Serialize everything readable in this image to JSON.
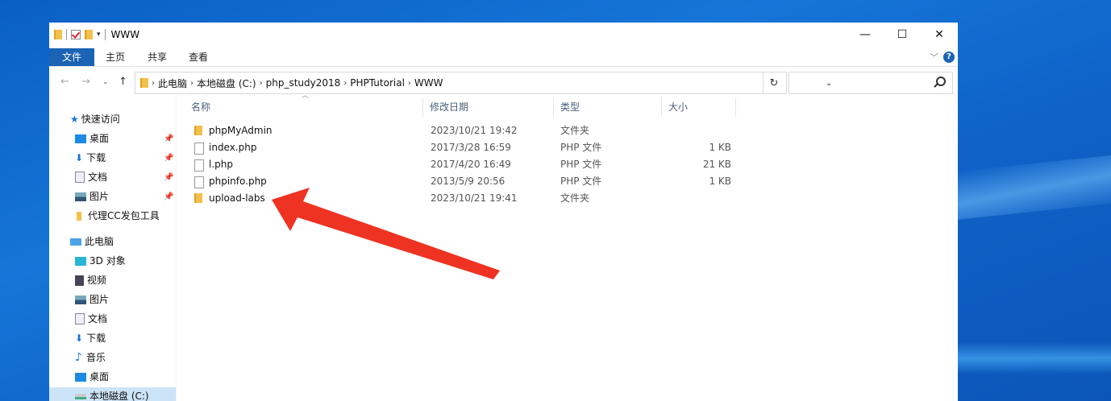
{
  "window": {
    "title": "WWW",
    "controls": {
      "minimize": "—",
      "maximize": "☐",
      "close": "✕"
    }
  },
  "ribbon": {
    "tabs": [
      "文件",
      "主页",
      "共享",
      "查看"
    ],
    "expand_icon": "chevron-down-icon",
    "help": "?"
  },
  "address": {
    "crumbs": [
      "此电脑",
      "本地磁盘 (C:)",
      "php_study2018",
      "PHPTutorial",
      "WWW"
    ],
    "search_placeholder": ""
  },
  "navpane": {
    "quick_access": "快速访问",
    "quick_items": [
      "桌面",
      "下载",
      "文档",
      "图片",
      "代理CC发包工具"
    ],
    "this_pc": "此电脑",
    "pc_items": [
      "3D 对象",
      "视频",
      "图片",
      "文档",
      "下载",
      "音乐",
      "桌面",
      "本地磁盘 (C:)"
    ]
  },
  "columns": {
    "name": "名称",
    "date": "修改日期",
    "type": "类型",
    "size": "大小"
  },
  "files": [
    {
      "name": "phpMyAdmin",
      "date": "2023/10/21 19:42",
      "type": "文件夹",
      "size": "",
      "kind": "folder"
    },
    {
      "name": "index.php",
      "date": "2017/3/28 16:59",
      "type": "PHP 文件",
      "size": "1 KB",
      "kind": "file"
    },
    {
      "name": "l.php",
      "date": "2017/4/20 16:49",
      "type": "PHP 文件",
      "size": "21 KB",
      "kind": "file"
    },
    {
      "name": "phpinfo.php",
      "date": "2013/5/9 20:56",
      "type": "PHP 文件",
      "size": "1 KB",
      "kind": "file"
    },
    {
      "name": "upload-labs",
      "date": "2023/10/21 19:41",
      "type": "文件夹",
      "size": "",
      "kind": "folder"
    }
  ],
  "annotation": {
    "arrow_color": "#ee3322"
  }
}
